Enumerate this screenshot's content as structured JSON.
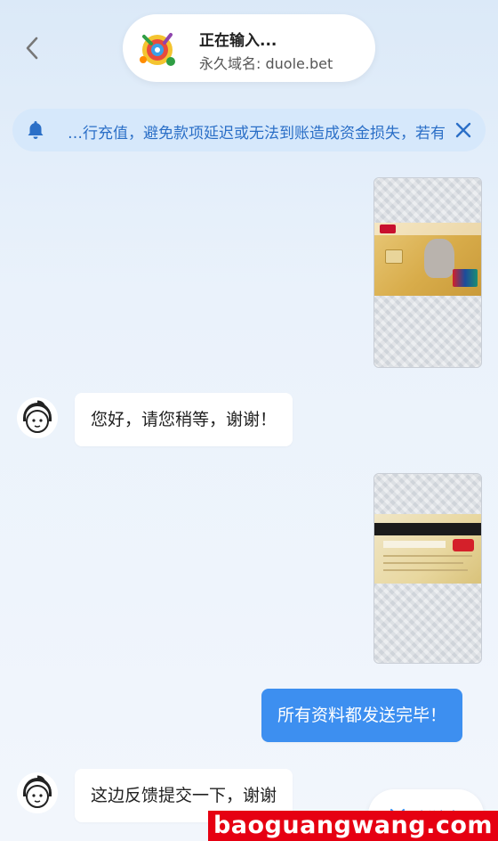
{
  "header": {
    "back_icon": "chevron-left-icon",
    "logo": "app-logo",
    "status": "正在输入...",
    "domain": "永久域名: duole.bet"
  },
  "notice": {
    "icon": "bell-icon",
    "text": "…行充值，避免款项延迟或无法到账造成资金损失，若有",
    "close_icon": "close-icon"
  },
  "messages": [
    {
      "type": "image",
      "side": "right",
      "content": "bank-card-front-photo"
    },
    {
      "type": "text",
      "side": "left",
      "text": "您好，请您稍等，谢谢！"
    },
    {
      "type": "image",
      "side": "right",
      "content": "bank-card-back-photo"
    },
    {
      "type": "text",
      "side": "right",
      "text": "所有资料都发送完毕！"
    },
    {
      "type": "text",
      "side": "left",
      "text": "这边反馈提交一下，谢谢"
    }
  ],
  "new_message_button": {
    "label": "新消息",
    "icon": "chevron-down-icon"
  },
  "watermark": "baoguangwang.com",
  "colors": {
    "accent": "#3d8ff0",
    "notice_bg": "#d6e8fb",
    "notice_text": "#2b6fc7",
    "watermark_bg": "#e60012"
  }
}
